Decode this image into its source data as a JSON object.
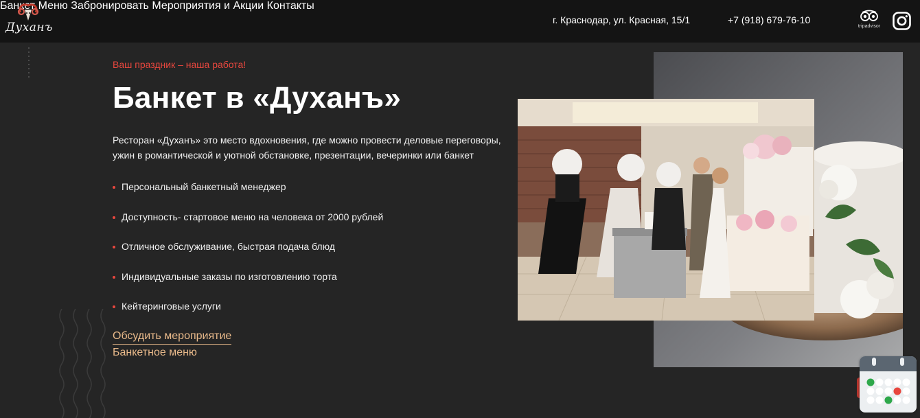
{
  "brand": {
    "logo_text": "Духанъ"
  },
  "nav": {
    "items": [
      {
        "label": "Банкет"
      },
      {
        "label": "Меню"
      },
      {
        "label": "Забронировать"
      },
      {
        "label": "Мероприятия и Акции"
      },
      {
        "label": "Контакты"
      }
    ],
    "address": "г. Краснодар, ул. Красная, 15/1",
    "phone": "+7 (918) 679-76-10",
    "tripadvisor_label": "tripadvisor",
    "tripadvisor_icon": "tripadvisor-owl-icon",
    "instagram_icon": "instagram-icon"
  },
  "hero": {
    "tagline": "Ваш праздник – наша работа!",
    "title": "Банкет в «Духанъ»",
    "description": "Ресторан «Духанъ» это  место вдохновения, где можно провести деловые переговоры, ужин в романтической и уютной обстановке, презентации, вечеринки или банкет",
    "features": [
      "Персональный банкетный менеджер",
      "Доступность- стартовое меню на человека от 2000 рублей",
      "Отличное обслуживание, быстрая подача блюд",
      "Индивидуальные заказы по изготовлению торта",
      "Кейтеринговые услуги"
    ],
    "primary_link": "Обсудить мероприятие",
    "secondary_link": "Банкетное меню"
  },
  "widget": {
    "icon": "calendar-icon"
  },
  "colors": {
    "accent_red": "#e8473e",
    "link_gold": "#e8b98a",
    "header_bg": "#141414",
    "page_bg": "#252525"
  }
}
